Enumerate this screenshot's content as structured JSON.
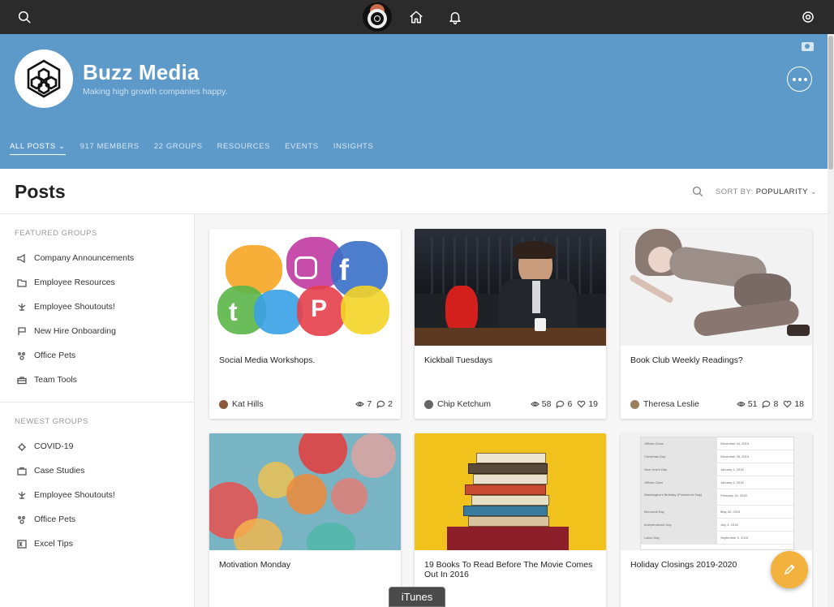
{
  "topbar": {
    "search_icon": "search-icon",
    "home_icon": "home-icon",
    "bell_icon": "bell-icon",
    "settings_icon": "gear-icon"
  },
  "org": {
    "name": "Buzz Media",
    "tagline": "Making high growth companies happy."
  },
  "tabs": [
    {
      "label": "ALL POSTS",
      "active": true
    },
    {
      "label": "917 MEMBERS"
    },
    {
      "label": "22 GROUPS"
    },
    {
      "label": "RESOURCES"
    },
    {
      "label": "EVENTS"
    },
    {
      "label": "INSIGHTS"
    }
  ],
  "posts": {
    "title": "Posts",
    "sort_prefix": "SORT BY:",
    "sort_value": "POPULARITY"
  },
  "sidebar": {
    "featured_heading": "FEATURED GROUPS",
    "featured": [
      {
        "label": "Company Announcements",
        "icon": "megaphone-icon"
      },
      {
        "label": "Employee Resources",
        "icon": "folder-icon"
      },
      {
        "label": "Employee Shoutouts!",
        "icon": "sparkle-icon"
      },
      {
        "label": "New Hire Onboarding",
        "icon": "flag-icon"
      },
      {
        "label": "Office Pets",
        "icon": "paw-icon"
      },
      {
        "label": "Team Tools",
        "icon": "toolbox-icon"
      }
    ],
    "newest_heading": "NEWEST GROUPS",
    "newest": [
      {
        "label": "COVID-19",
        "icon": "virus-icon"
      },
      {
        "label": "Case Studies",
        "icon": "briefcase-icon"
      },
      {
        "label": "Employee Shoutouts!",
        "icon": "sparkle-icon"
      },
      {
        "label": "Office Pets",
        "icon": "paw-icon"
      },
      {
        "label": "Excel Tips",
        "icon": "excel-icon"
      }
    ]
  },
  "cards": [
    {
      "title": "Social Media Workshops.",
      "author": "Kat Hills",
      "views": "7",
      "comments": "2",
      "likes": ""
    },
    {
      "title": "Kickball Tuesdays",
      "author": "Chip Ketchum",
      "views": "58",
      "comments": "6",
      "likes": "19"
    },
    {
      "title": "Book Club Weekly Readings?",
      "author": "Theresa Leslie",
      "views": "51",
      "comments": "8",
      "likes": "18"
    },
    {
      "title": "Motivation Monday",
      "author": "",
      "views": "",
      "comments": "",
      "likes": ""
    },
    {
      "title": "19 Books To Read Before The Movie Comes Out In 2016",
      "author": "",
      "views": "",
      "comments": "",
      "likes": ""
    },
    {
      "title": "Holiday Closings 2019-2020",
      "author": "",
      "views": "",
      "comments": "",
      "likes": ""
    }
  ],
  "holiday_table": [
    [
      "Offices Close",
      "December 24, 2015"
    ],
    [
      "Christmas Day",
      "December 25, 2015"
    ],
    [
      "New Year's Day",
      "January 1, 2016"
    ],
    [
      "Offices Open",
      "January 4, 2016"
    ],
    [
      "Washington's Birthday (President's Day)",
      "February 15, 2016"
    ],
    [
      "Memorial Day",
      "May 30, 2016"
    ],
    [
      "Independence Day",
      "July 4, 2016"
    ],
    [
      "Labor Day",
      "September 5, 2016"
    ]
  ],
  "overlay": {
    "itunes_label": "iTunes"
  },
  "colors": {
    "banner": "#5d9ac9",
    "topbar": "#2b2b2b",
    "fab": "#f2b23d"
  }
}
